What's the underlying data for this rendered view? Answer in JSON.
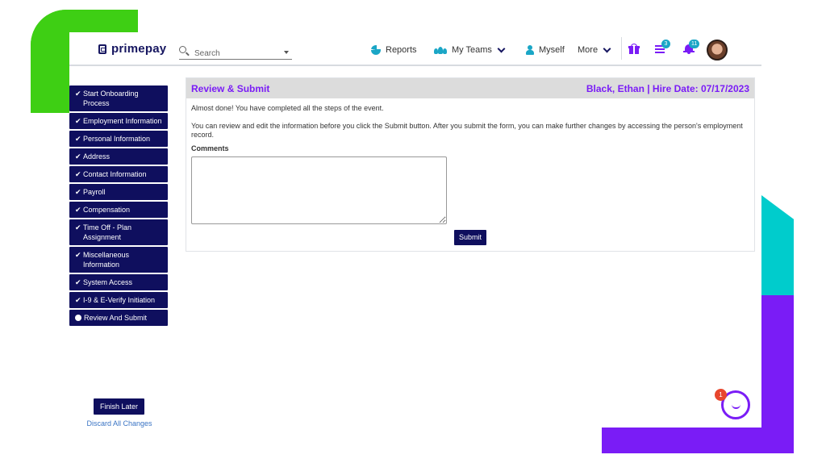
{
  "brand": {
    "logo_text": "primepay",
    "accent": "#7a1cf6",
    "navy": "#0f0f5e",
    "teal": "#1aa6c6"
  },
  "header": {
    "search_placeholder": "Search",
    "nav": [
      {
        "label": "Reports",
        "icon": "pie-chart-icon"
      },
      {
        "label": "My Teams",
        "icon": "team-icon"
      },
      {
        "label": "Myself",
        "icon": "person-icon"
      },
      {
        "label": "More",
        "icon": "chevron-down-icon"
      }
    ],
    "tasks_badge": "3",
    "notifications_badge": "11"
  },
  "sidebar": {
    "steps": [
      {
        "label": "Start Onboarding Process",
        "status": "done"
      },
      {
        "label": "Employment Information",
        "status": "done"
      },
      {
        "label": "Personal Information",
        "status": "done"
      },
      {
        "label": "Address",
        "status": "done"
      },
      {
        "label": "Contact Information",
        "status": "done"
      },
      {
        "label": "Payroll",
        "status": "done"
      },
      {
        "label": "Compensation",
        "status": "done"
      },
      {
        "label": "Time Off - Plan Assignment",
        "status": "done"
      },
      {
        "label": "Miscellaneous Information",
        "status": "done"
      },
      {
        "label": "System Access",
        "status": "done"
      },
      {
        "label": "I-9 & E-Verify Initiation",
        "status": "done"
      },
      {
        "label": "Review And Submit",
        "status": "current"
      }
    ],
    "finish_later": "Finish Later",
    "discard": "Discard All Changes"
  },
  "main": {
    "title": "Review & Submit",
    "person_line": "Black, Ethan | Hire Date: 07/17/2023",
    "p1": "Almost done! You have completed all the steps of the event.",
    "p2": "You can review and edit the information before you click the Submit button. After you submit the form, you can make further changes by accessing the person's employment record.",
    "comments_label": "Comments",
    "comments_value": "",
    "submit": "Submit"
  },
  "chat": {
    "badge": "1"
  }
}
